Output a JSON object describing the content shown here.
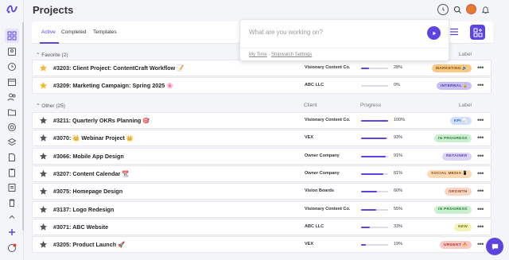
{
  "app": {
    "title": "Projects"
  },
  "tabs": [
    {
      "label": "Active",
      "active": true
    },
    {
      "label": "Completed",
      "active": false
    },
    {
      "label": "Templates",
      "active": false
    }
  ],
  "timer_popup": {
    "placeholder": "What are you working on?",
    "link_my_time": "My Time",
    "separator": "·",
    "link_stopwatch": "Stopwatch Settings"
  },
  "columns": {
    "label": "Label",
    "client": "Client",
    "progress": "Progress"
  },
  "favorite_section": {
    "title": "Favorite (2)"
  },
  "other_section": {
    "title": "Other (25)"
  },
  "favorite_rows": [
    {
      "name": "#3203: Client Project: ContentCraft Workflow 📝",
      "client": "Visionary Content Co.",
      "progress": 28,
      "progress_text": "28%",
      "label": "MARKETING 🔊",
      "label_bg": "#f7c987",
      "label_fg": "#8a4d06",
      "starred": true
    },
    {
      "name": "#3209: Marketing Campaign: Spring 2025 🌸",
      "client": "ABC LLC",
      "progress": 0,
      "progress_text": "0%",
      "label": "INTERNAL 🔒",
      "label_bg": "#c9bff4",
      "label_fg": "#4b3aa9",
      "starred": true
    }
  ],
  "other_rows": [
    {
      "name": "#3211: Quarterly OKRs Planning 🎯",
      "client": "Visionary Content Co.",
      "progress": 100,
      "progress_text": "100%",
      "label": "KPI 📈",
      "label_bg": "#cfe0fb",
      "label_fg": "#2f5fb5"
    },
    {
      "name": "#3070: 👑 Webinar Project 👑",
      "client": "VEX",
      "progress": 93,
      "progress_text": "93%",
      "label": "IN PROGRESS",
      "label_bg": "#c9efce",
      "label_fg": "#2b7a3a"
    },
    {
      "name": "#3066: Mobile App Design",
      "client": "Owner Company",
      "progress": 91,
      "progress_text": "91%",
      "label": "RETAINER",
      "label_bg": "#dcd3f7",
      "label_fg": "#5a45b8"
    },
    {
      "name": "#3207: Content Calendar 📆",
      "client": "Owner Company",
      "progress": 81,
      "progress_text": "81%",
      "label": "SOCIAL MEDIA 📱",
      "label_bg": "#fbd9b4",
      "label_fg": "#8a4d06"
    },
    {
      "name": "#3075: Homepage Design",
      "client": "Vision Boards",
      "progress": 60,
      "progress_text": "60%",
      "label": "GROWTH",
      "label_bg": "#f8d6c6",
      "label_fg": "#9a4424"
    },
    {
      "name": "#3137: Logo Redesign",
      "client": "Visionary Content Co.",
      "progress": 55,
      "progress_text": "55%",
      "label": "IN PROGRESS",
      "label_bg": "#c9efce",
      "label_fg": "#2b7a3a"
    },
    {
      "name": "#3071: ABC Website",
      "client": "ABC LLC",
      "progress": 33,
      "progress_text": "33%",
      "label": "NEW",
      "label_bg": "#f6f3b8",
      "label_fg": "#7a7410"
    },
    {
      "name": "#3205: Product Launch 🚀",
      "client": "VEX",
      "progress": 19,
      "progress_text": "19%",
      "label": "URGENT 🔥",
      "label_bg": "#f9c9c4",
      "label_fg": "#b0302a"
    }
  ],
  "more_glyph": "•••",
  "colors": {
    "accent": "#5c44e0",
    "background": "#f4f5f8"
  }
}
